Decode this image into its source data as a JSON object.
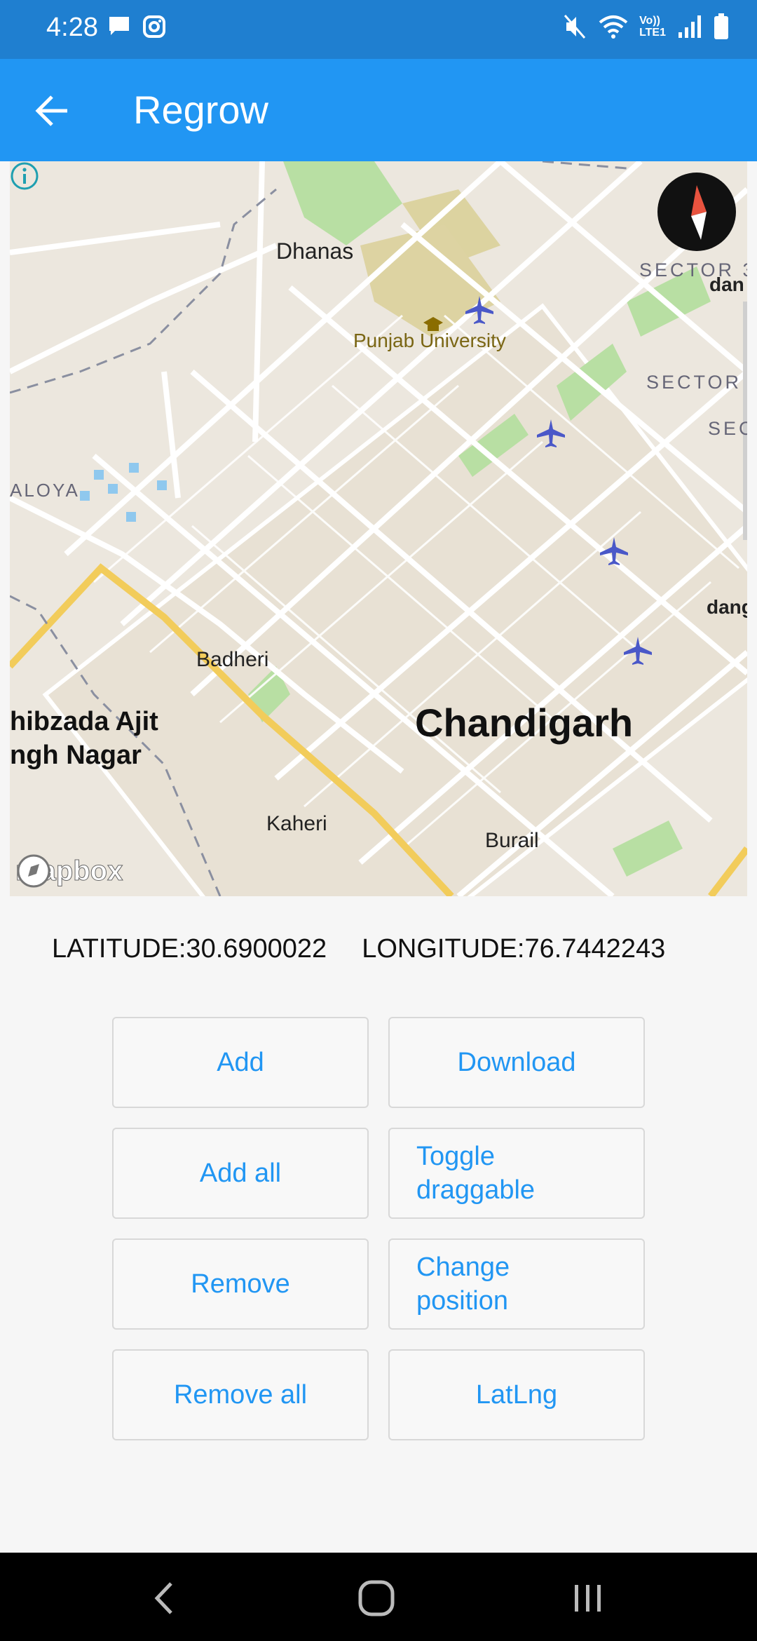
{
  "status_bar": {
    "time": "4:28",
    "left_icons": [
      "message-icon",
      "instagram-icon"
    ],
    "right_icons": [
      "mute-icon",
      "wifi-icon",
      "volte-icon",
      "signal-icon",
      "battery-icon"
    ],
    "volte_label_top": "Vo))",
    "volte_label_bottom": "LTE1"
  },
  "app_bar": {
    "title": "Regrow",
    "back_icon": "arrow-left-icon",
    "color": "#2196f3"
  },
  "map": {
    "labels": {
      "dhanas": "Dhanas",
      "punjab_university": "Punjab University",
      "sector_a": "SECTOR 3",
      "sector_b": "SECTOR",
      "sector_c": "SEC",
      "dan_a": "dan",
      "dan_b": "dang",
      "aloya": "ALOYA",
      "badheri": "Badheri",
      "chandigarh": "Chandigarh",
      "sahibzada_line1": "hibzada Ajit",
      "sahibzada_line2": "ngh Nagar",
      "kaheri": "Kaheri",
      "burail": "Burail"
    },
    "attribution": "mapbox",
    "marker_icon": "airplane-icon",
    "marker_count": 4
  },
  "coordinates": {
    "latitude": "LATITUDE:30.6900022",
    "longitude": "LONGITUDE:76.7442243"
  },
  "buttons": {
    "add": "Add",
    "download": "Download",
    "add_all": "Add all",
    "toggle_draggable_line1": "Toggle",
    "toggle_draggable_line2": "draggable",
    "remove": "Remove",
    "change_position_line1": "Change",
    "change_position_line2": "position",
    "remove_all": "Remove all",
    "latlng": "LatLng"
  },
  "nav_bar": {
    "icons": [
      "nav-back-icon",
      "nav-home-icon",
      "nav-recents-icon"
    ]
  }
}
